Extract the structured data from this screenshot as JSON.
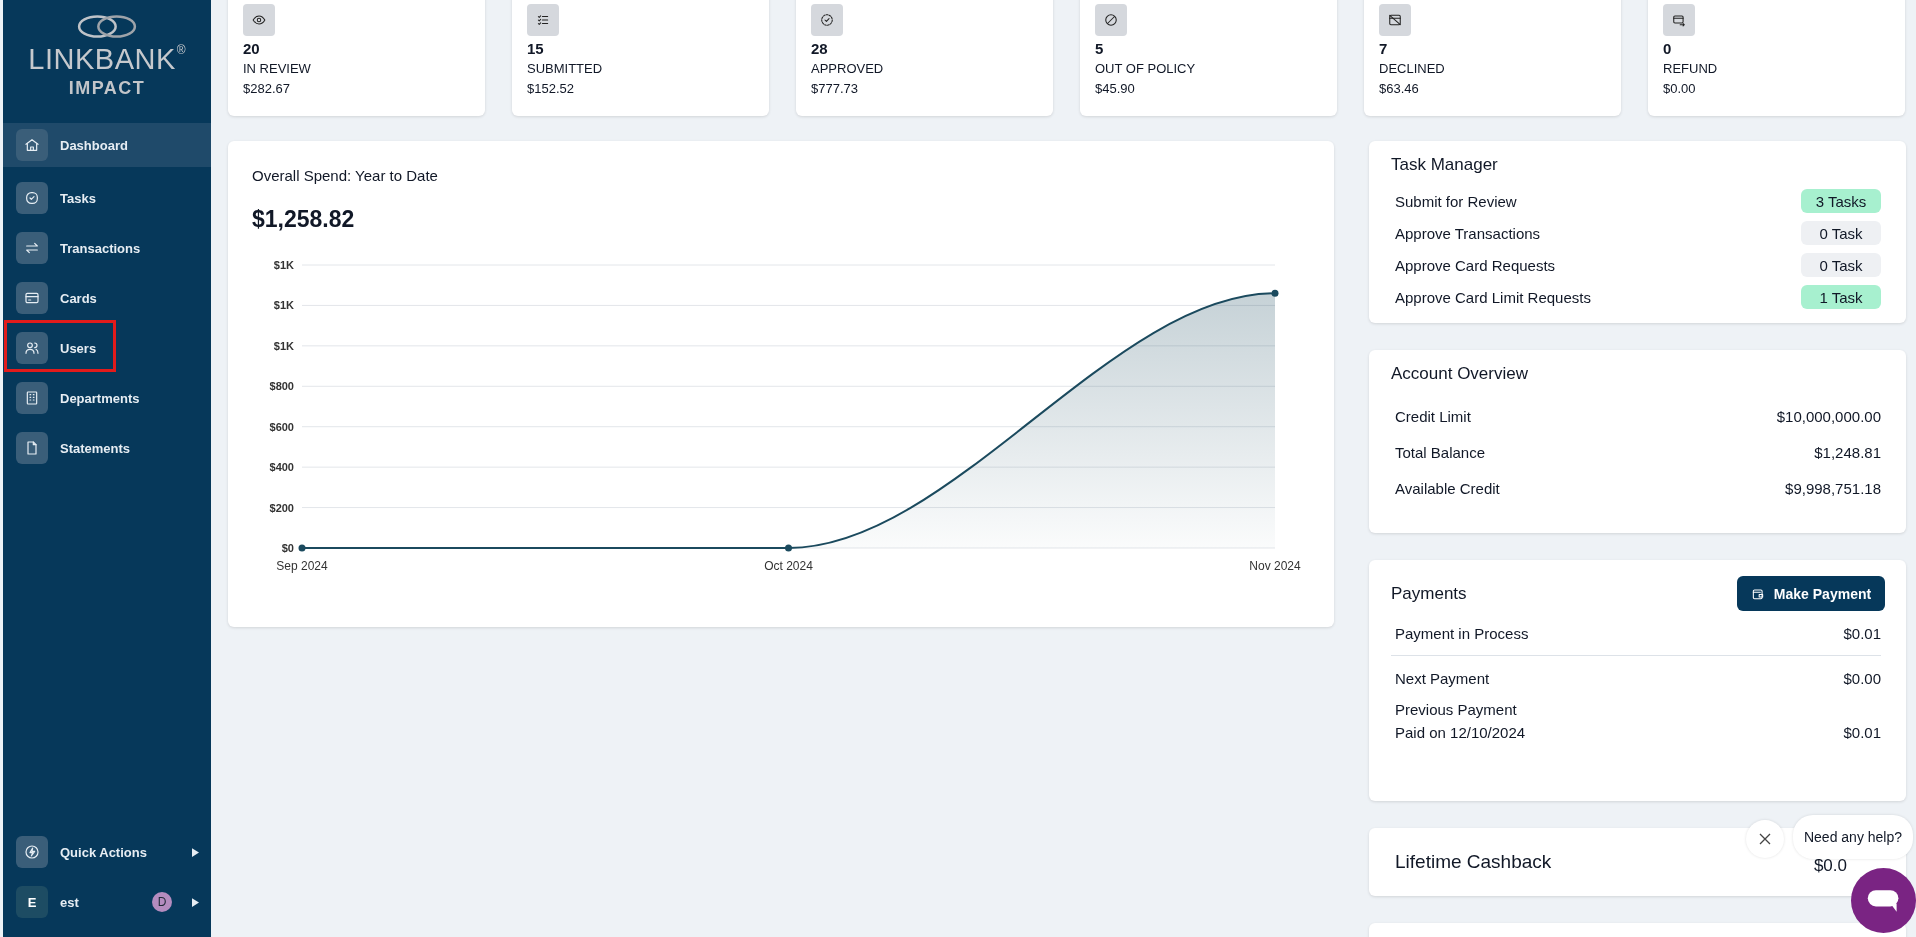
{
  "sidebar": {
    "logo": {
      "wordmark": "LINKBANK",
      "registered": "®",
      "subtitle": "IMPACT"
    },
    "nav_items": [
      {
        "label": "Dashboard",
        "selected": true,
        "annotated": false
      },
      {
        "label": "Tasks",
        "selected": false,
        "annotated": false
      },
      {
        "label": "Transactions",
        "selected": false,
        "annotated": false
      },
      {
        "label": "Cards",
        "selected": false,
        "annotated": false
      },
      {
        "label": "Users",
        "selected": false,
        "annotated": true
      },
      {
        "label": "Departments",
        "selected": false,
        "annotated": false
      },
      {
        "label": "Statements",
        "selected": false,
        "annotated": false
      }
    ],
    "quick_actions": {
      "label": "Quick Actions"
    },
    "user": {
      "initial": "E",
      "name": "est",
      "badge": "D"
    }
  },
  "status_cards": [
    {
      "count": "20",
      "label": "IN REVIEW",
      "amount": "$282.67"
    },
    {
      "count": "15",
      "label": "SUBMITTED",
      "amount": "$152.52"
    },
    {
      "count": "28",
      "label": "APPROVED",
      "amount": "$777.73"
    },
    {
      "count": "5",
      "label": "OUT OF POLICY",
      "amount": "$45.90"
    },
    {
      "count": "7",
      "label": "DECLINED",
      "amount": "$63.46"
    },
    {
      "count": "0",
      "label": "REFUND",
      "amount": "$0.00"
    }
  ],
  "spend": {
    "title": "Overall Spend: Year to Date",
    "total": "$1,258.82",
    "chart_data": {
      "type": "area",
      "categories": [
        "Sep 2024",
        "Oct 2024",
        "Nov 2024"
      ],
      "series": [
        {
          "color": "#1b4a5e",
          "values": [
            0,
            0,
            1260
          ]
        }
      ],
      "grid": true,
      "ylim": [
        0,
        1400
      ],
      "yticks": [
        {
          "value": 0,
          "label": "$0"
        },
        {
          "value": 200,
          "label": "$200"
        },
        {
          "value": 400,
          "label": "$400"
        },
        {
          "value": 600,
          "label": "$600"
        },
        {
          "value": 800,
          "label": "$800"
        },
        {
          "value": 1000,
          "label": "$1K"
        },
        {
          "value": 1200,
          "label": "$1K"
        },
        {
          "value": 1400,
          "label": "$1K"
        }
      ]
    }
  },
  "task_manager": {
    "title": "Task Manager",
    "tasks": [
      {
        "label": "Submit for Review",
        "count": "3 Tasks",
        "highlighted": true
      },
      {
        "label": "Approve Transactions",
        "count": "0 Task",
        "highlighted": false
      },
      {
        "label": "Approve Card Requests",
        "count": "0 Task",
        "highlighted": false
      },
      {
        "label": "Approve Card Limit Requests",
        "count": "1 Task",
        "highlighted": true
      }
    ]
  },
  "account_overview": {
    "title": "Account Overview",
    "rows": [
      {
        "label": "Credit Limit",
        "value": "$10,000,000.00"
      },
      {
        "label": "Total Balance",
        "value": "$1,248.81"
      },
      {
        "label": "Available Credit",
        "value": "$9,998,751.18"
      }
    ]
  },
  "payments": {
    "title": "Payments",
    "button": "Make Payment",
    "rows": [
      {
        "label": "Payment in Process",
        "value": "$0.01",
        "divider": true
      },
      {
        "label": "Next Payment",
        "value": "$0.00",
        "divider": false
      },
      {
        "label": "Previous Payment",
        "sublabel": "Paid on 12/10/2024",
        "value": "$0.01",
        "divider": false
      }
    ]
  },
  "lifetime_cashback": {
    "title": "Lifetime Cashback",
    "value": "$0.0"
  },
  "chat": {
    "help_text": "Need any help?"
  }
}
